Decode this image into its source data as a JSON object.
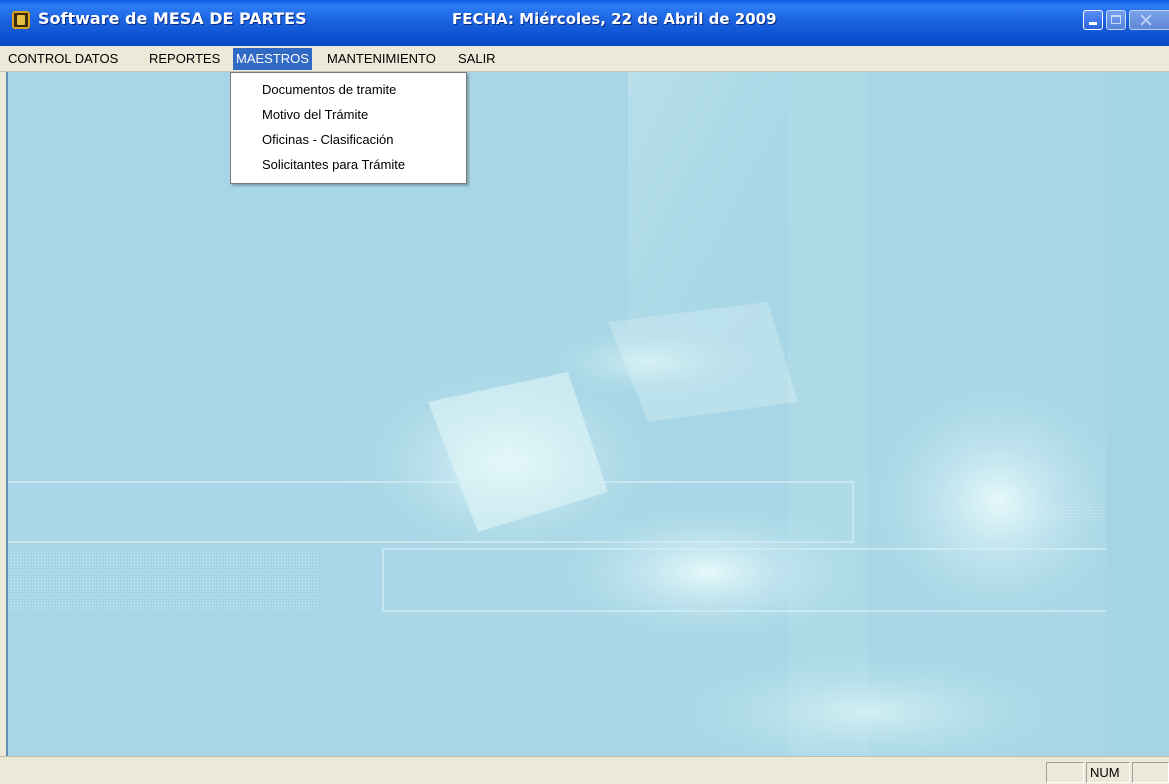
{
  "window": {
    "title": "Software de MESA DE PARTES",
    "date": "FECHA: Miércoles, 22 de Abril de 2009",
    "titlebar_color": "#0b4fcf"
  },
  "menubar": {
    "items": [
      {
        "label": "CONTROL DATOS"
      },
      {
        "label": "REPORTES"
      },
      {
        "label": "MAESTROS",
        "active": true
      },
      {
        "label": "MANTENIMIENTO"
      },
      {
        "label": "SALIR"
      }
    ],
    "highlight_color": "#316ac5"
  },
  "dropdown": {
    "parent": "MAESTROS",
    "items": [
      {
        "label": "Documentos de tramite"
      },
      {
        "label": "Motivo del Trámite"
      },
      {
        "label": "Oficinas - Clasificación"
      },
      {
        "label": "Solicitantes para Trámite"
      }
    ]
  },
  "statusbar": {
    "panels": [
      "",
      "NUM",
      ""
    ]
  },
  "client": {
    "background_color": "#a8d6e6"
  }
}
